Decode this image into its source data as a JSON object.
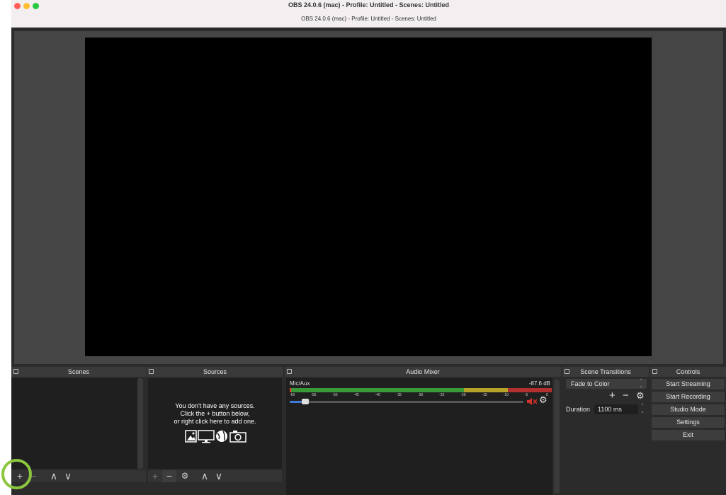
{
  "window": {
    "title": "OBS 24.0.6 (mac) - Profile: Untitled - Scenes: Untitled",
    "subtitle": "OBS 24.0.6 (mac) - Profile: Untitled - Scenes: Untitled"
  },
  "docks": {
    "scenes": {
      "title": "Scenes",
      "toolbar": {
        "add": "+",
        "remove": "−",
        "up": "∧",
        "down": "∨"
      }
    },
    "sources": {
      "title": "Sources",
      "empty_line1": "You don't have any sources.",
      "empty_line2": "Click the + button below,",
      "empty_line3": "or right click here to add one.",
      "toolbar": {
        "add": "+",
        "remove": "−",
        "settings": "⚙",
        "up": "∧",
        "down": "∨"
      }
    },
    "audio_mixer": {
      "title": "Audio Mixer",
      "channel": {
        "name": "Mic/Aux",
        "level": "-87.6 dB",
        "volume_fraction": 0.05,
        "muted": true
      },
      "ticks": [
        "-60",
        "-55",
        "-50",
        "-45",
        "-40",
        "-35",
        "-30",
        "-25",
        "-20",
        "-15",
        "-10",
        "-5",
        "0"
      ]
    },
    "transitions": {
      "title": "Scene Transitions",
      "selected": "Fade to Color",
      "duration_label": "Duration",
      "duration_value": "1100 ms",
      "add": "+",
      "remove": "−",
      "settings": "⚙"
    },
    "controls": {
      "title": "Controls",
      "buttons": [
        "Start Streaming",
        "Start Recording",
        "Studio Mode",
        "Settings",
        "Exit"
      ]
    }
  },
  "colors": {
    "highlight_circle": "#8cc63f",
    "meter_green": "#3a9a3a",
    "meter_yellow": "#b6a42a",
    "meter_red": "#b33030",
    "mute_red": "#d0312d"
  }
}
